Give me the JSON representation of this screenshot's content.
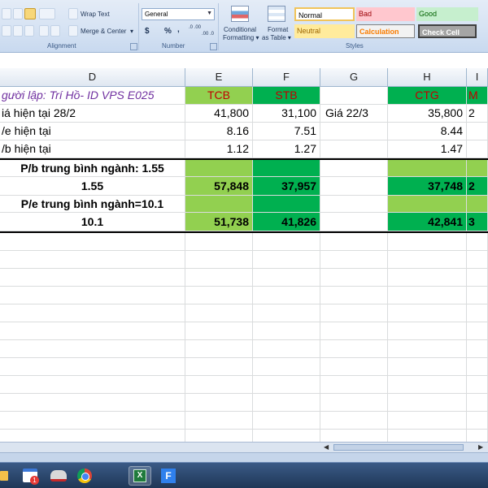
{
  "ribbon": {
    "wrap_text": "Wrap Text",
    "merge_center": "Merge & Center",
    "merge_arrow": "▾",
    "number_format": "General",
    "currency": "$",
    "percent": "%",
    "comma": ",",
    "inc_decimal": ".0 .00",
    "dec_decimal": ".00 .0",
    "alignment_label": "Alignment",
    "number_label": "Number",
    "styles_label": "Styles",
    "conditional_formatting_line1": "Conditional",
    "conditional_formatting_line2": "Formatting ▾",
    "format_as_table_line1": "Format",
    "format_as_table_line2": "as Table ▾",
    "styles": {
      "normal": "Normal",
      "bad": "Bad",
      "good": "Good",
      "neutral": "Neutral",
      "calculation": "Calculation",
      "check_cell": "Check Cell"
    }
  },
  "columns": [
    "D",
    "E",
    "F",
    "G",
    "H",
    "I"
  ],
  "rows": {
    "r1": {
      "d": "gười lập: Trí Hồ- ID VPS E025",
      "e": "TCB",
      "f": "STB",
      "g": "",
      "h": "CTG",
      "i": "M"
    },
    "r2": {
      "d": "iá hiện tại 28/2",
      "e": "41,800",
      "f": "31,100",
      "g": "Giá  22/3",
      "h": "35,800",
      "i": "2"
    },
    "r3": {
      "d": "/e hiện tại",
      "e": "8.16",
      "f": "7.51",
      "g": "",
      "h": "8.44",
      "i": ""
    },
    "r4": {
      "d": "/b hiện tại",
      "e": "1.12",
      "f": "1.27",
      "g": "",
      "h": "1.47",
      "i": ""
    },
    "r5": {
      "d": "P/b trung bình ngành: 1.55",
      "e": "",
      "f": "",
      "g": "",
      "h": "",
      "i": ""
    },
    "r6": {
      "d": "1.55",
      "e": "57,848",
      "f": "37,957",
      "g": "",
      "h": "37,748",
      "i": "2"
    },
    "r7": {
      "d": "P/e trung bình ngành=10.1",
      "e": "",
      "f": "",
      "g": "",
      "h": "",
      "i": ""
    },
    "r8": {
      "d": "10.1",
      "e": "51,738",
      "f": "41,826",
      "g": "",
      "h": "42,841",
      "i": "3"
    }
  },
  "colors": {
    "light_green": "#92d050",
    "dark_green": "#00b050",
    "header_red": "#c00000",
    "author_purple": "#7030a0"
  },
  "taskbar": {
    "icons": [
      "windows-explorer-icon",
      "calendar-icon",
      "media-player-icon",
      "chrome-icon",
      "excel-icon",
      "f-app-icon"
    ],
    "calendar_badge": "1",
    "f_app_label": "F"
  }
}
